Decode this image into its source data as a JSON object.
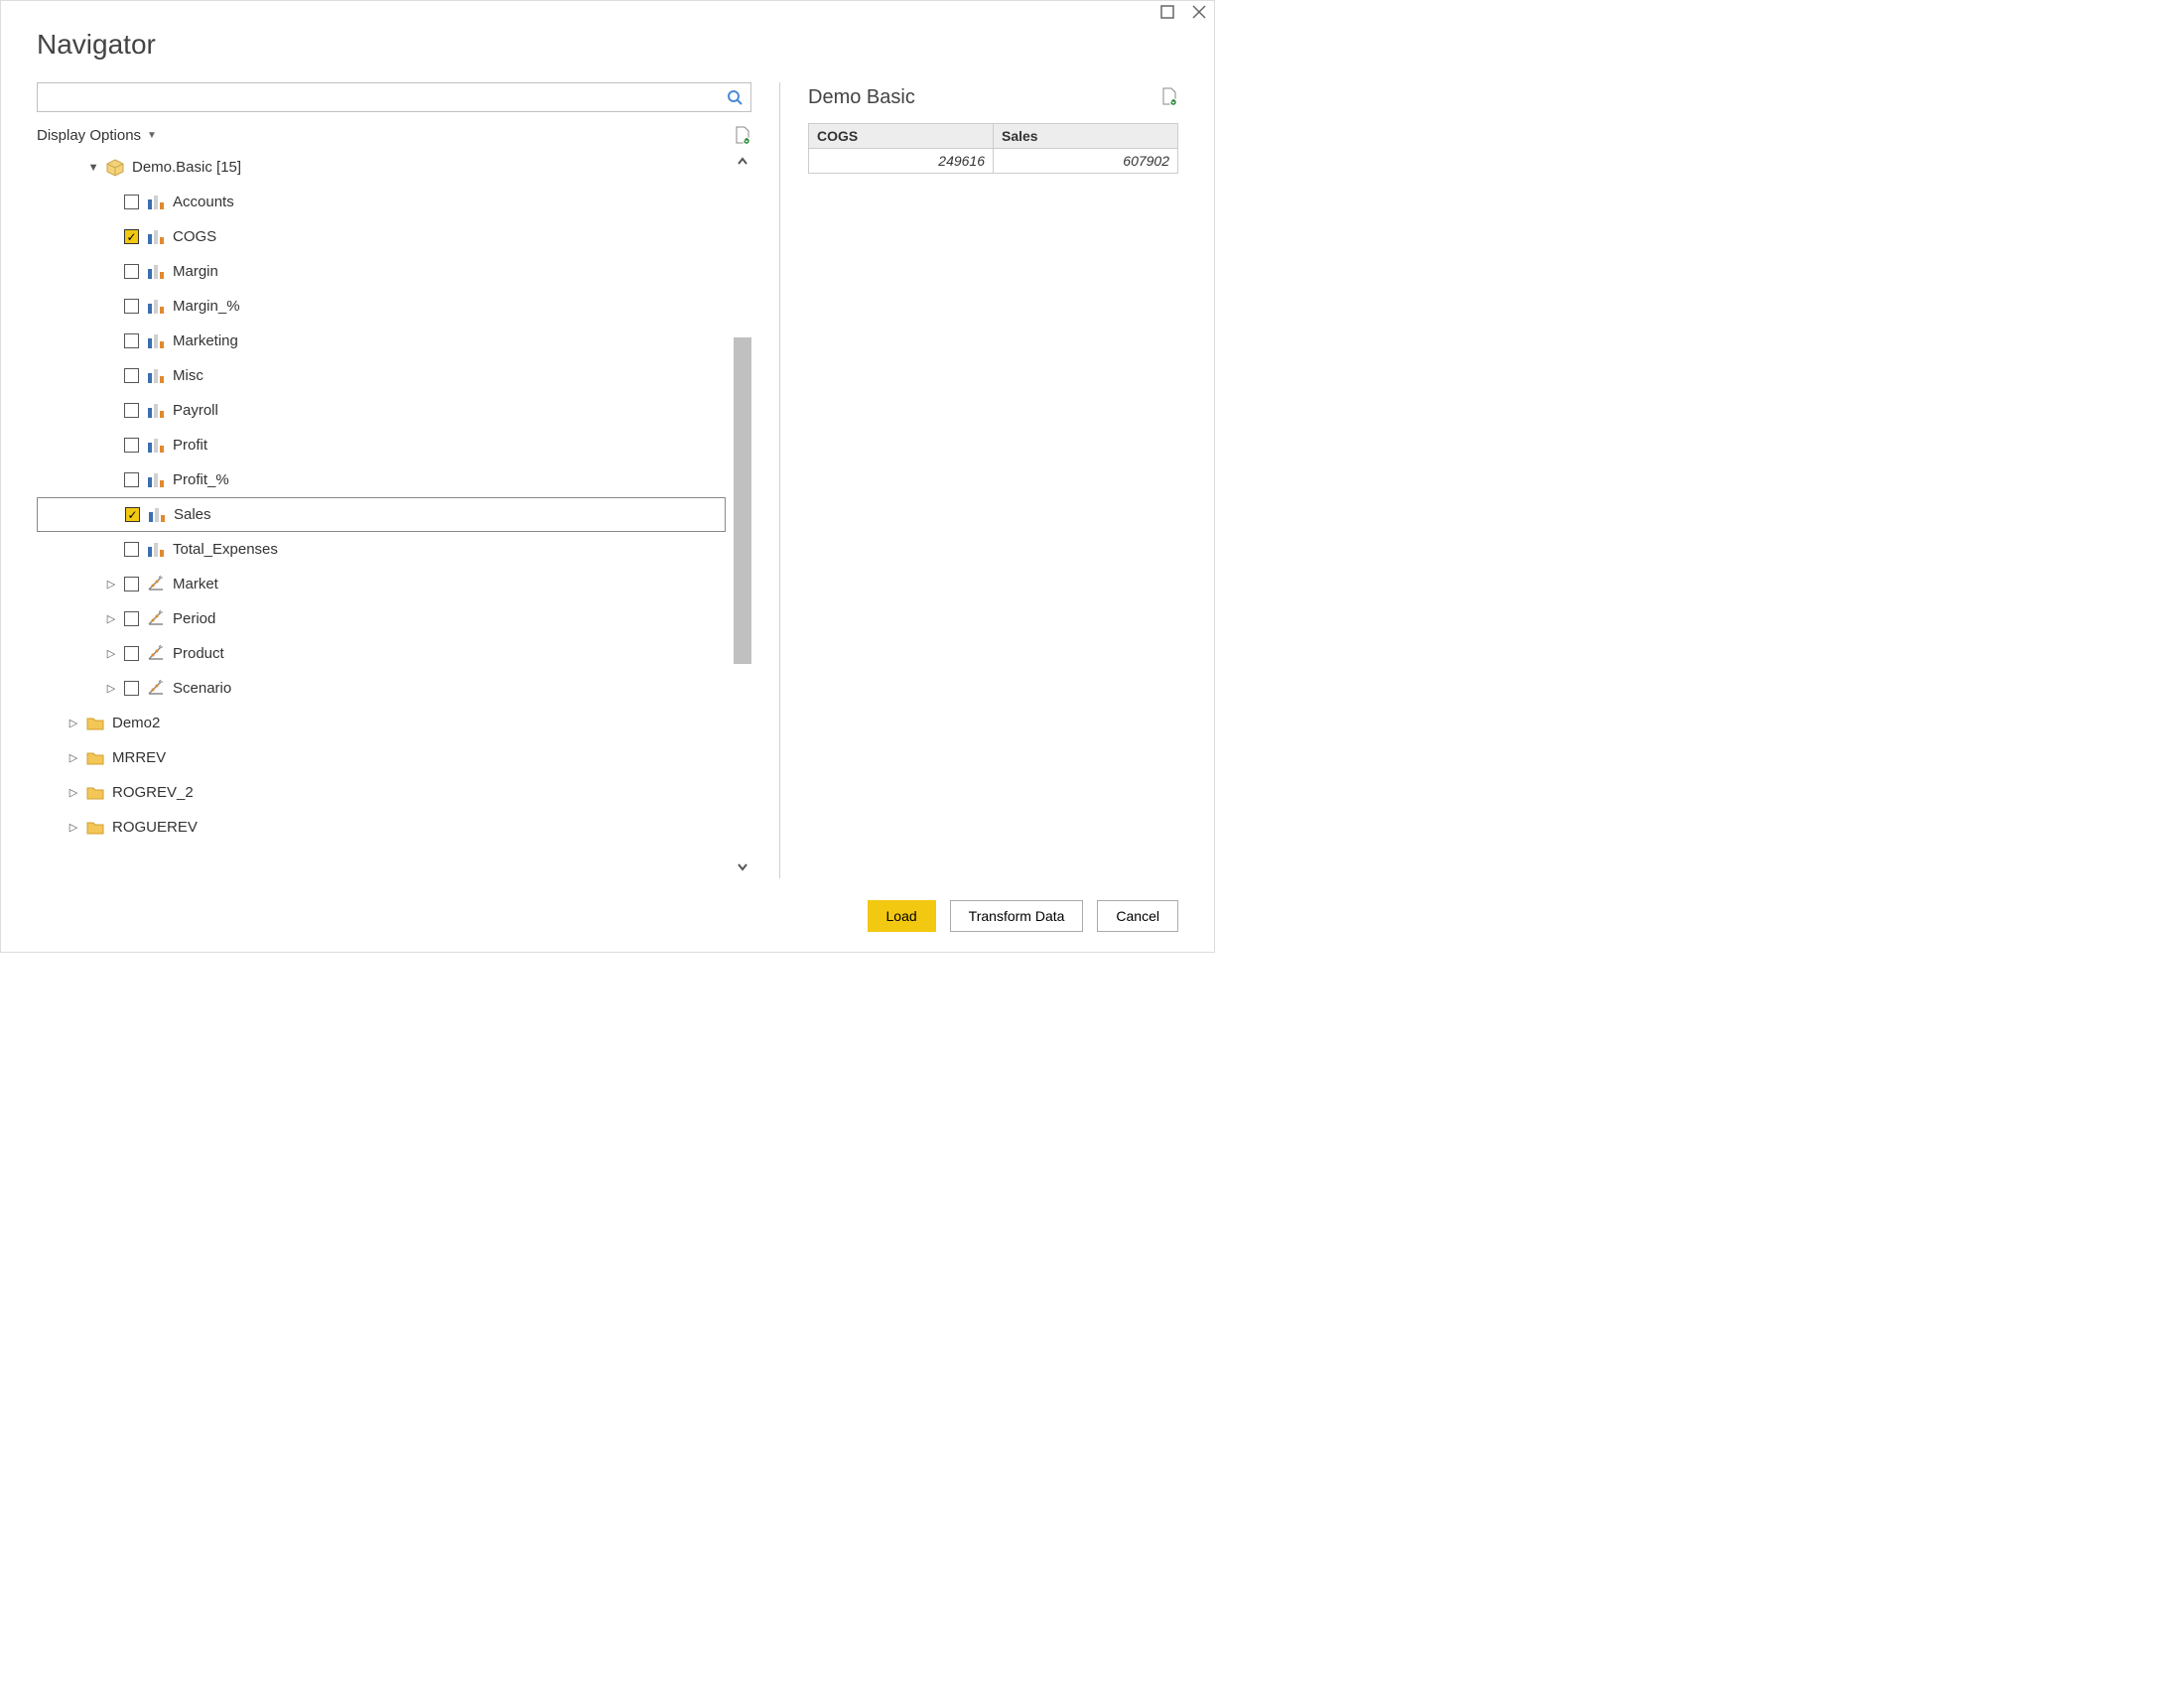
{
  "window": {
    "title": "Navigator"
  },
  "search": {
    "value": "",
    "placeholder": ""
  },
  "display_options_label": "Display Options",
  "tree": {
    "root": {
      "label": "Demo.Basic [15]"
    },
    "items": [
      {
        "label": "Accounts",
        "checked": false,
        "icon": "bars"
      },
      {
        "label": "COGS",
        "checked": true,
        "icon": "bars"
      },
      {
        "label": "Margin",
        "checked": false,
        "icon": "bars"
      },
      {
        "label": "Margin_%",
        "checked": false,
        "icon": "bars"
      },
      {
        "label": "Marketing",
        "checked": false,
        "icon": "bars"
      },
      {
        "label": "Misc",
        "checked": false,
        "icon": "bars"
      },
      {
        "label": "Payroll",
        "checked": false,
        "icon": "bars"
      },
      {
        "label": "Profit",
        "checked": false,
        "icon": "bars"
      },
      {
        "label": "Profit_%",
        "checked": false,
        "icon": "bars"
      },
      {
        "label": "Sales",
        "checked": true,
        "icon": "bars",
        "selected": true
      },
      {
        "label": "Total_Expenses",
        "checked": false,
        "icon": "bars"
      },
      {
        "label": "Market",
        "checked": false,
        "icon": "dim",
        "expandable": true
      },
      {
        "label": "Period",
        "checked": false,
        "icon": "dim",
        "expandable": true
      },
      {
        "label": "Product",
        "checked": false,
        "icon": "dim",
        "expandable": true
      },
      {
        "label": "Scenario",
        "checked": false,
        "icon": "dim",
        "expandable": true
      }
    ],
    "siblings": [
      {
        "label": "Demo2"
      },
      {
        "label": "MRREV"
      },
      {
        "label": "ROGREV_2"
      },
      {
        "label": "ROGUEREV"
      }
    ]
  },
  "preview": {
    "title": "Demo Basic",
    "columns": [
      "COGS",
      "Sales"
    ],
    "rows": [
      [
        "249616",
        "607902"
      ]
    ]
  },
  "buttons": {
    "load": "Load",
    "transform": "Transform Data",
    "cancel": "Cancel"
  }
}
